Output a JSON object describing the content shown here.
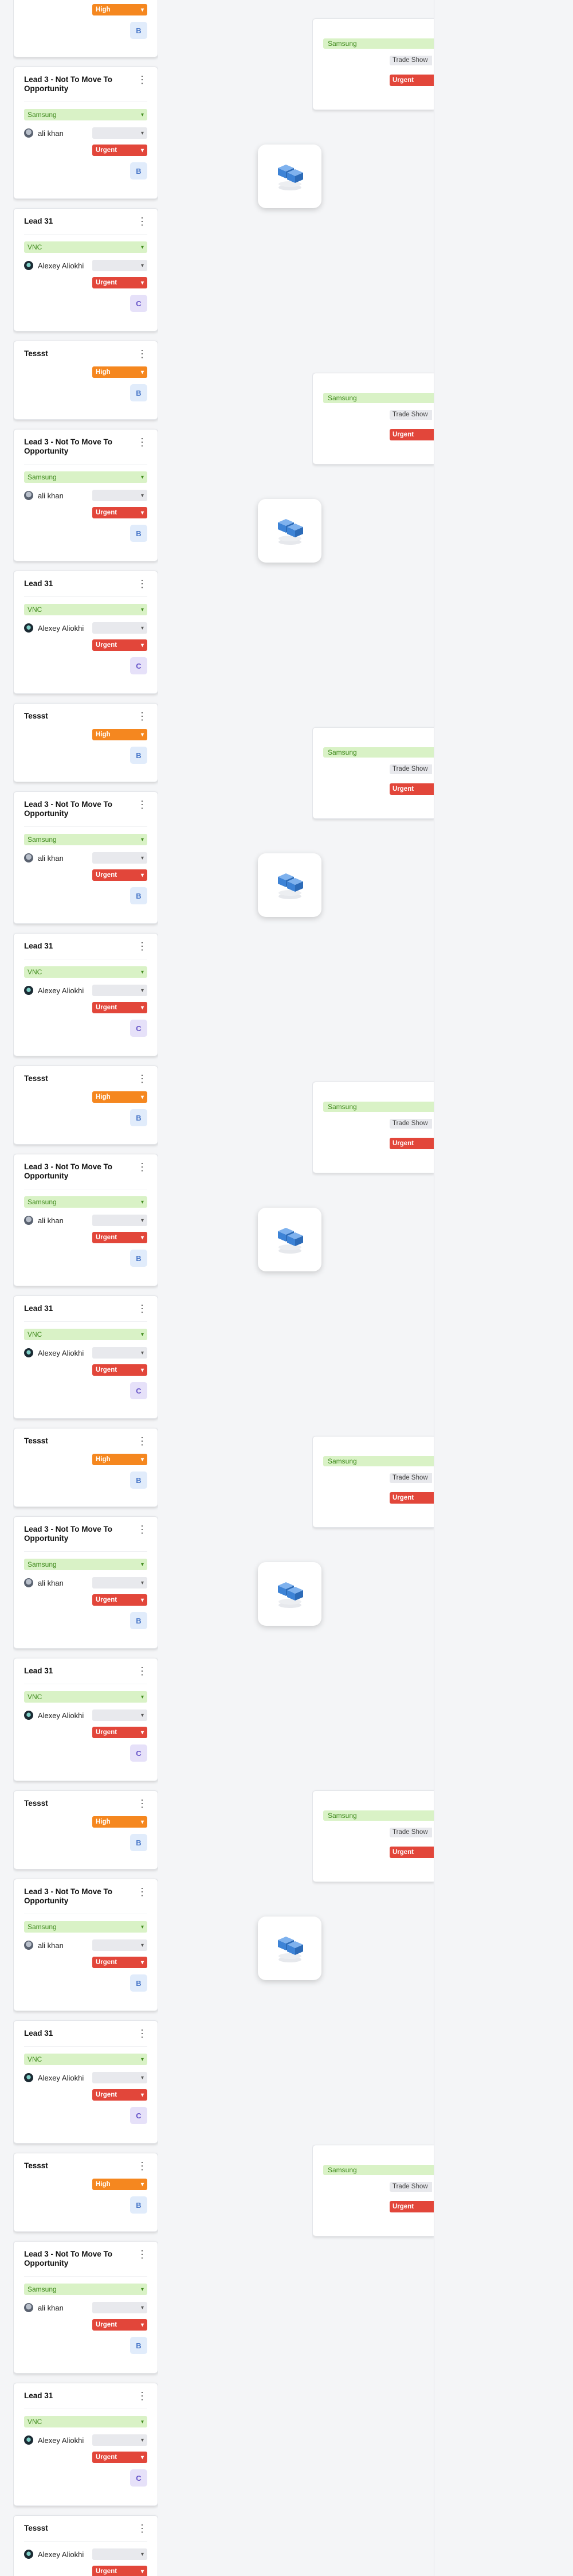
{
  "labels": {
    "tessst": "Tessst",
    "lead3": "Lead 3 - Not To Move To Opportunity",
    "lead31": "Lead 31",
    "samsung": "Samsung",
    "vnc": "VNC",
    "ali_khan": "ali khan",
    "alexey": "Alexey Aliokhi",
    "urgent": "Urgent",
    "high": "High",
    "trade_show": "Trade Show",
    "badge_b": "B",
    "badge_c": "C",
    "kebab": "⋮",
    "caret": "▾"
  },
  "icons": {
    "more": "kebab-icon",
    "dropdown": "chevron-down-icon",
    "empty_state": "empty-stack-icon",
    "owner_avatar": "avatar"
  },
  "colors": {
    "urgent": "#e2463a",
    "high": "#f5871f",
    "company_bg": "#d9f2c6",
    "company_text": "#3f8a1c",
    "badge_b_bg": "#e1ecfb",
    "badge_c_bg": "#e6e1f9",
    "empty_icon": "#3d83d6"
  },
  "leads_column": {
    "cards": [
      {
        "kind": "tessst",
        "title": "Tessst",
        "priority": "High",
        "badge": "B"
      },
      {
        "kind": "lead3",
        "title": "Lead 3 - Not To Move To Opportunity",
        "company": "Samsung",
        "owner": "ali khan",
        "priority": "Urgent",
        "badge": "B"
      },
      {
        "kind": "lead31",
        "title": "Lead 31",
        "company": "VNC",
        "owner": "Alexey Aliokhi",
        "priority": "Urgent",
        "badge": "C"
      },
      {
        "kind": "tessst",
        "title": "Tessst",
        "priority": "High",
        "badge": "B"
      },
      {
        "kind": "lead3",
        "title": "Lead 3 - Not To Move To Opportunity",
        "company": "Samsung",
        "owner": "ali khan",
        "priority": "Urgent",
        "badge": "B"
      },
      {
        "kind": "lead31",
        "title": "Lead 31",
        "company": "VNC",
        "owner": "Alexey Aliokhi",
        "priority": "Urgent",
        "badge": "C"
      },
      {
        "kind": "tessst",
        "title": "Tessst",
        "priority": "High",
        "badge": "B"
      },
      {
        "kind": "lead3",
        "title": "Lead 3 - Not To Move To Opportunity",
        "company": "Samsung",
        "owner": "ali khan",
        "priority": "Urgent",
        "badge": "B"
      },
      {
        "kind": "lead31",
        "title": "Lead 31",
        "company": "VNC",
        "owner": "Alexey Aliokhi",
        "priority": "Urgent",
        "badge": "C"
      },
      {
        "kind": "tessst",
        "title": "Tessst",
        "priority": "High",
        "badge": "B"
      },
      {
        "kind": "lead3",
        "title": "Lead 3 - Not To Move To Opportunity",
        "company": "Samsung",
        "owner": "ali khan",
        "priority": "Urgent",
        "badge": "B"
      },
      {
        "kind": "lead31",
        "title": "Lead 31",
        "company": "VNC",
        "owner": "Alexey Aliokhi",
        "priority": "Urgent",
        "badge": "C"
      },
      {
        "kind": "tessst",
        "title": "Tessst",
        "priority": "High",
        "badge": "B"
      },
      {
        "kind": "lead3",
        "title": "Lead 3 - Not To Move To Opportunity",
        "company": "Samsung",
        "owner": "ali khan",
        "priority": "Urgent",
        "badge": "B"
      },
      {
        "kind": "lead31",
        "title": "Lead 31",
        "company": "VNC",
        "owner": "Alexey Aliokhi",
        "priority": "Urgent",
        "badge": "C"
      },
      {
        "kind": "tessst",
        "title": "Tessst",
        "priority": "High",
        "badge": "B"
      },
      {
        "kind": "lead3",
        "title": "Lead 3 - Not To Move To Opportunity",
        "company": "Samsung",
        "owner": "ali khan",
        "priority": "Urgent",
        "badge": "B"
      },
      {
        "kind": "lead31",
        "title": "Lead 31",
        "company": "VNC",
        "owner": "Alexey Aliokhi",
        "priority": "Urgent",
        "badge": "C"
      },
      {
        "kind": "tessst",
        "title": "Tessst",
        "priority": "High",
        "badge": "B"
      },
      {
        "kind": "lead3",
        "title": "Lead 3 - Not To Move To Opportunity",
        "company": "Samsung",
        "owner": "ali khan",
        "priority": "Urgent",
        "badge": "B"
      },
      {
        "kind": "lead31",
        "title": "Lead 31",
        "company": "VNC",
        "owner": "Alexey Aliokhi",
        "priority": "Urgent",
        "badge": "C"
      },
      {
        "kind": "final",
        "title": "Tessst",
        "owner": "Alexey Aliokhi",
        "priority": "Urgent",
        "badge": "C"
      },
      {
        "kind": "final_top",
        "title": "Tessst"
      }
    ]
  },
  "opportunity_column": {
    "cards": [
      {
        "company": "Samsung",
        "source": "Trade Show",
        "priority": "Urgent"
      },
      {
        "company": "Samsung",
        "source": "Trade Show",
        "priority": "Urgent"
      },
      {
        "company": "Samsung",
        "source": "Trade Show",
        "priority": "Urgent"
      },
      {
        "company": "Samsung",
        "source": "Trade Show",
        "priority": "Urgent"
      },
      {
        "company": "Samsung",
        "source": "Trade Show",
        "priority": "Urgent"
      },
      {
        "company": "Samsung",
        "source": "Trade Show",
        "priority": "Urgent"
      },
      {
        "company": "Samsung",
        "source": "Trade Show",
        "priority": "Urgent"
      },
      {
        "company": "Samsung",
        "source": "Trade Show",
        "priority": "Urgent"
      }
    ]
  },
  "empty_columns": {
    "count": 7
  }
}
